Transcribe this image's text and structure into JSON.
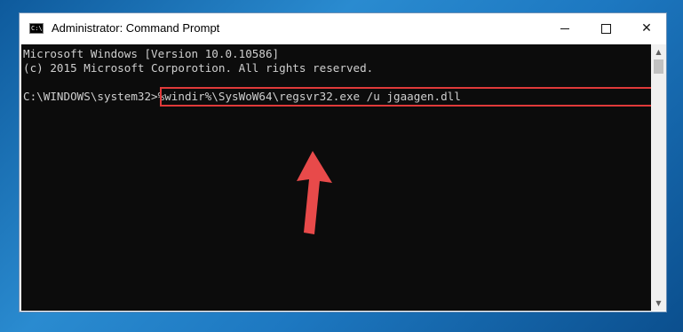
{
  "window": {
    "title": "Administrator: Command Prompt",
    "icon_text": "C:\\",
    "controls": {
      "minimize": "minimize-icon",
      "maximize": "maximize-icon",
      "close": "close-icon"
    }
  },
  "console": {
    "lines": [
      "Microsoft Windows [Version 10.0.10586]",
      "(c) 2015 Microsoft Corporotion. All rights reserved.",
      "C:\\WINDOWS\\system32>%windir%\\SysWoW64\\regsvr32.exe /u jgaagen.dll"
    ]
  },
  "colors": {
    "highlight": "#e03a3a",
    "console_bg": "#0c0c0c",
    "console_text": "#cfcfcf"
  }
}
